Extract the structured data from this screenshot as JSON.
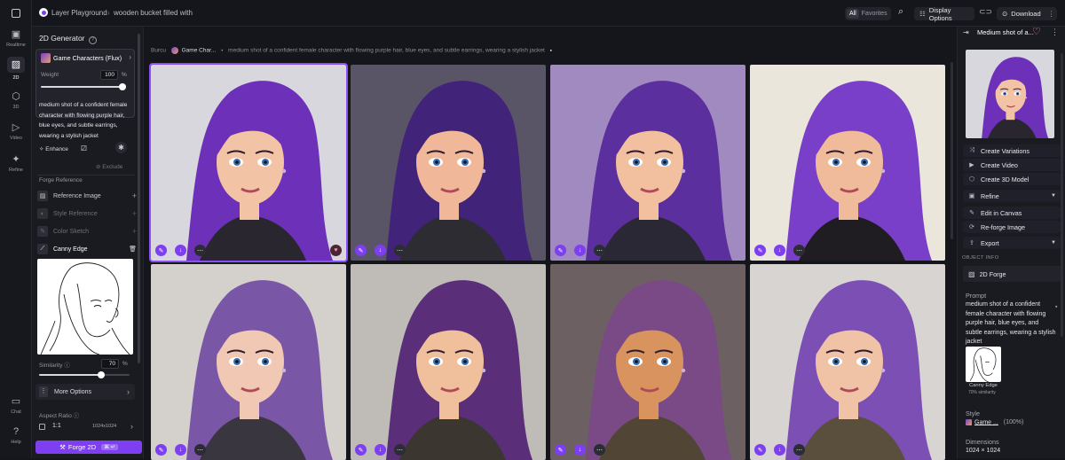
{
  "topbar": {
    "breadcrumb_root": "Layer Playground",
    "breadcrumb_sep": "›",
    "breadcrumb_current": "wooden bucket filled with",
    "filter_all": "All",
    "filter_favorites": "Favorites",
    "display_options": "Display Options",
    "download": "Download"
  },
  "rail": {
    "items": [
      {
        "label": "Realtime",
        "icon": "realtime-icon"
      },
      {
        "label": "2D",
        "icon": "image-icon"
      },
      {
        "label": "3D",
        "icon": "cube-icon"
      },
      {
        "label": "Video",
        "icon": "play-icon"
      },
      {
        "label": "Refine",
        "icon": "sparkle-icon"
      }
    ],
    "bottom": [
      {
        "label": "Chat",
        "icon": "chat-icon"
      },
      {
        "label": "Help",
        "icon": "help-icon"
      }
    ]
  },
  "left_panel": {
    "title": "2D Generator",
    "model_name": "Game Characters (Flux)",
    "weight_label": "Weight",
    "weight_value": "100",
    "weight_unit": "%",
    "weight_fraction": 1.0,
    "prompt": "medium shot of a confident female character with flowing purple hair, blue eyes, and subtle earrings, wearing a stylish jacket",
    "enhance_label": "Enhance",
    "exclude_label": "Exclude",
    "forge_reference_label": "Forge Reference",
    "reference_image_label": "Reference Image",
    "style_reference_label": "Style Reference",
    "color_sketch_label": "Color Sketch",
    "canny_edge_label": "Canny Edge",
    "similarity_label": "Similarity",
    "similarity_value": "70",
    "similarity_unit": "%",
    "similarity_fraction": 0.7,
    "more_options_label": "More Options",
    "aspect_ratio_label": "Aspect Ratio",
    "aspect_value": "1:1",
    "aspect_size": "1024x1024",
    "forge_button": "Forge 2D",
    "forge_shortcut": "⌘ ↵"
  },
  "gallery": {
    "author": "Burcu",
    "model_chip": "Game Char...",
    "prompt_preview": "medium shot of a confident female character with flowing purple hair, blue eyes, and subtle earrings, wearing a stylish jacket",
    "tiles": [
      {
        "bg": "#d9d7de",
        "hair": "#6d30b8",
        "skin": "#f3c3a6",
        "jacket": "#2a2630",
        "selected": true
      },
      {
        "bg": "#5a5566",
        "hair": "#41237a",
        "skin": "#f0b898",
        "jacket": "#2e2c33",
        "selected": false
      },
      {
        "bg": "#a08ac0",
        "hair": "#5c2f9e",
        "skin": "#f2bf9f",
        "jacket": "#2a2834",
        "selected": false
      },
      {
        "bg": "#ebe6dc",
        "hair": "#7a3fc8",
        "skin": "#f0bb9a",
        "jacket": "#1f1d22",
        "selected": false
      },
      {
        "bg": "#d4d0cc",
        "hair": "#7956a6",
        "skin": "#f0c8b4",
        "jacket": "#3a3640",
        "selected": false
      },
      {
        "bg": "#bfbcb8",
        "hair": "#5a2e78",
        "skin": "#f0c09c",
        "jacket": "#3b3630",
        "selected": false
      },
      {
        "bg": "#6d6062",
        "hair": "#7a4a86",
        "skin": "#d9935f",
        "jacket": "#514636",
        "selected": false
      },
      {
        "bg": "#d8d4d2",
        "hair": "#7c4fb4",
        "skin": "#f0c3a6",
        "jacket": "#5a4e3c",
        "selected": false
      }
    ]
  },
  "right_panel": {
    "title": "Medium shot of a...",
    "actions": [
      {
        "label": "Create Variations",
        "icon": "shuffle-icon"
      },
      {
        "label": "Create Video",
        "icon": "video-icon"
      },
      {
        "label": "Create 3D Model",
        "icon": "cube-icon"
      },
      {
        "label": "Refine",
        "icon": "refine-icon"
      },
      {
        "label": "Edit in Canvas",
        "icon": "brush-icon"
      },
      {
        "label": "Re-forge Image",
        "icon": "reforge-icon"
      },
      {
        "label": "Export",
        "icon": "export-icon"
      }
    ],
    "object_info_label": "OBJECT INFO",
    "forge_type": "2D Forge",
    "prompt_label": "Prompt",
    "prompt": "medium shot of a confident female character with flowing purple hair, blue eyes, and subtle earrings, wearing a stylish jacket",
    "ref_caption": "Canny Edge",
    "ref_similarity": "70% similarity",
    "style_label": "Style",
    "style_value": "Game ...",
    "style_weight": "(100%)",
    "dimensions_label": "Dimensions",
    "dimensions_value": "1024 × 1024"
  },
  "colors": {
    "accent": "#7d3ff0",
    "background": "#15151c",
    "panel": "#1a1a21"
  }
}
